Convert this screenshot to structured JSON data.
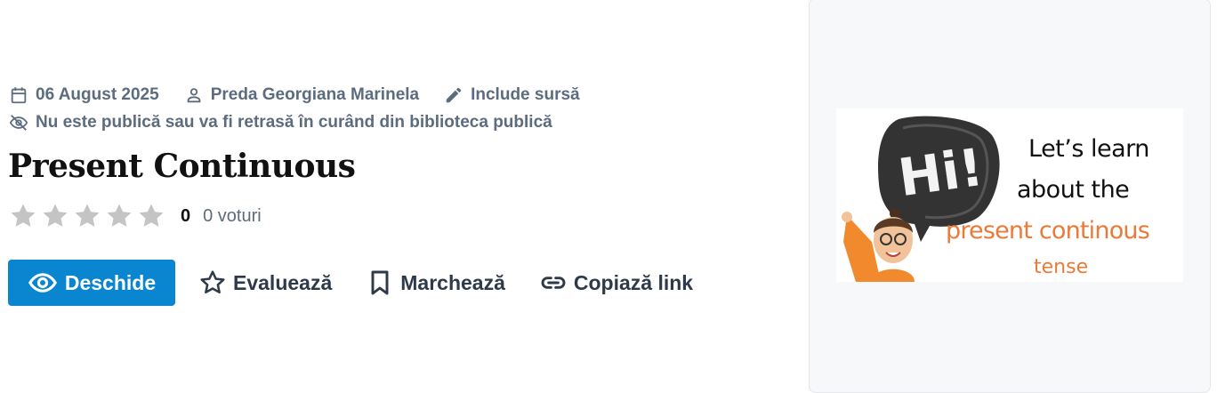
{
  "meta": {
    "date": "06 August 2025",
    "author": "Preda Georgiana Marinela",
    "source": "Include sursă",
    "visibility_notice": "Nu este publică sau va fi retrasă în curând din biblioteca publică"
  },
  "title": "Present Continuous",
  "rating": {
    "stars_total": 5,
    "stars_filled": 0,
    "value": "0",
    "votes": "0 voturi",
    "star_color": "#c4c4c4"
  },
  "actions": {
    "open": "Deschide",
    "rate": "Evaluează",
    "bookmark": "Marchează",
    "copy_link": "Copiază link"
  },
  "thumbnail": {
    "bubble_text": "Hi!",
    "line1": "Let’s learn",
    "line2": "about the",
    "line3": "present continous",
    "line4": "tense",
    "accent_color": "#ea7a38"
  },
  "colors": {
    "primary": "#0a86d0",
    "meta_text": "#5d6b7e",
    "panel_bg": "#f7f8fa"
  }
}
